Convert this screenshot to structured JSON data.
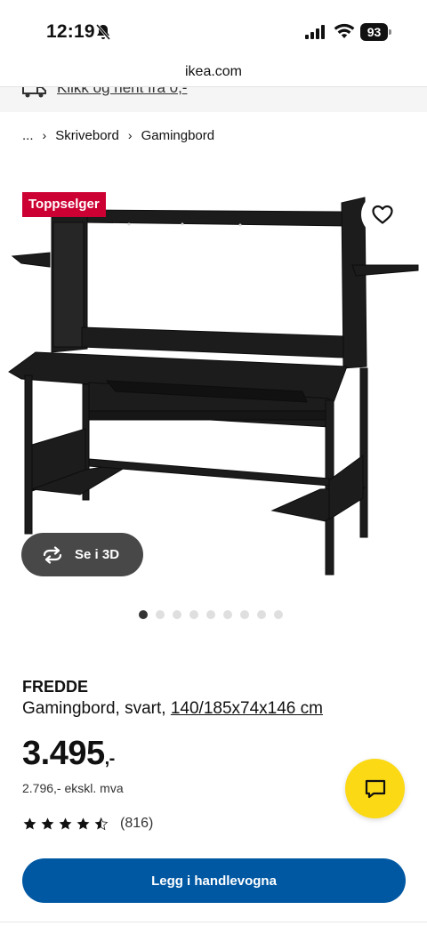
{
  "status_bar": {
    "time": "12:19",
    "battery": "93"
  },
  "browser": {
    "url": "ikea.com"
  },
  "promo": {
    "text": "Klikk og hent fra 0,-"
  },
  "breadcrumb": {
    "items": [
      "...",
      "Skrivebord",
      "Gamingbord"
    ]
  },
  "gallery": {
    "badge": "Toppselger",
    "view_3d_label": "Se i 3D",
    "image_count": 9,
    "active_index": 0
  },
  "product": {
    "name": "FREDDE",
    "description": "Gamingbord, svart, ",
    "dimensions": "140/185x74x146 cm",
    "price": "3.495",
    "price_suffix": ",-",
    "price_ex_vat": "2.796,- ekskl. mva",
    "rating": 4.5,
    "review_count": "(816)"
  },
  "actions": {
    "add_to_cart": "Legg i handlevogna"
  },
  "colors": {
    "badge": "#cc0033",
    "primary": "#0058a3",
    "chat": "#fbd914",
    "button_3d": "#484848"
  }
}
